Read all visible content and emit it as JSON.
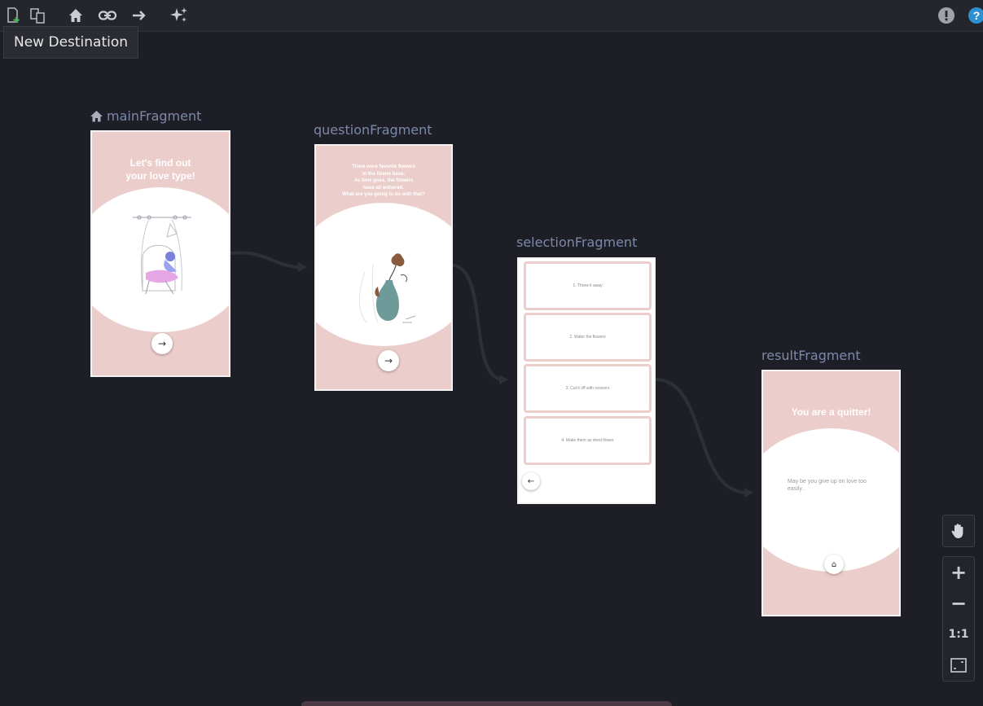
{
  "toolbar": {
    "tooltip": "New Destination",
    "icons": [
      "new-destination-icon",
      "nested-graph-icon",
      "start-destination-icon",
      "deep-link-icon",
      "action-icon",
      "auto-arrange-icon",
      "warning-icon",
      "help-icon"
    ]
  },
  "fragments": {
    "main": {
      "label": "mainFragment",
      "headline_line1": "Let's find out",
      "headline_line2": "your love type!",
      "fab": "→"
    },
    "question": {
      "label": "questionFragment",
      "lines": [
        "There were favorite flowers",
        "in the flower base.",
        "As time goes, the flowers",
        "have all withered.",
        "What are you going to do with that?"
      ],
      "fab": "→"
    },
    "selection": {
      "label": "selectionFragment",
      "options": [
        "1. Threw it away",
        "2. Water the flowers",
        "3. Cut it off with scissors",
        "4. Make them as dried flower"
      ],
      "back": "←"
    },
    "result": {
      "label": "resultFragment",
      "headline": "You are a quitter!",
      "text": "May be you give up on love too easily..",
      "fab": "⌂"
    }
  },
  "zoom": {
    "one_to_one": "1:1",
    "plus": "+",
    "minus": "−"
  },
  "colors": {
    "background": "#1e1f26",
    "screen_pink": "#ebcdcb",
    "label": "#7d87aa",
    "arrow": "#2e3038"
  }
}
